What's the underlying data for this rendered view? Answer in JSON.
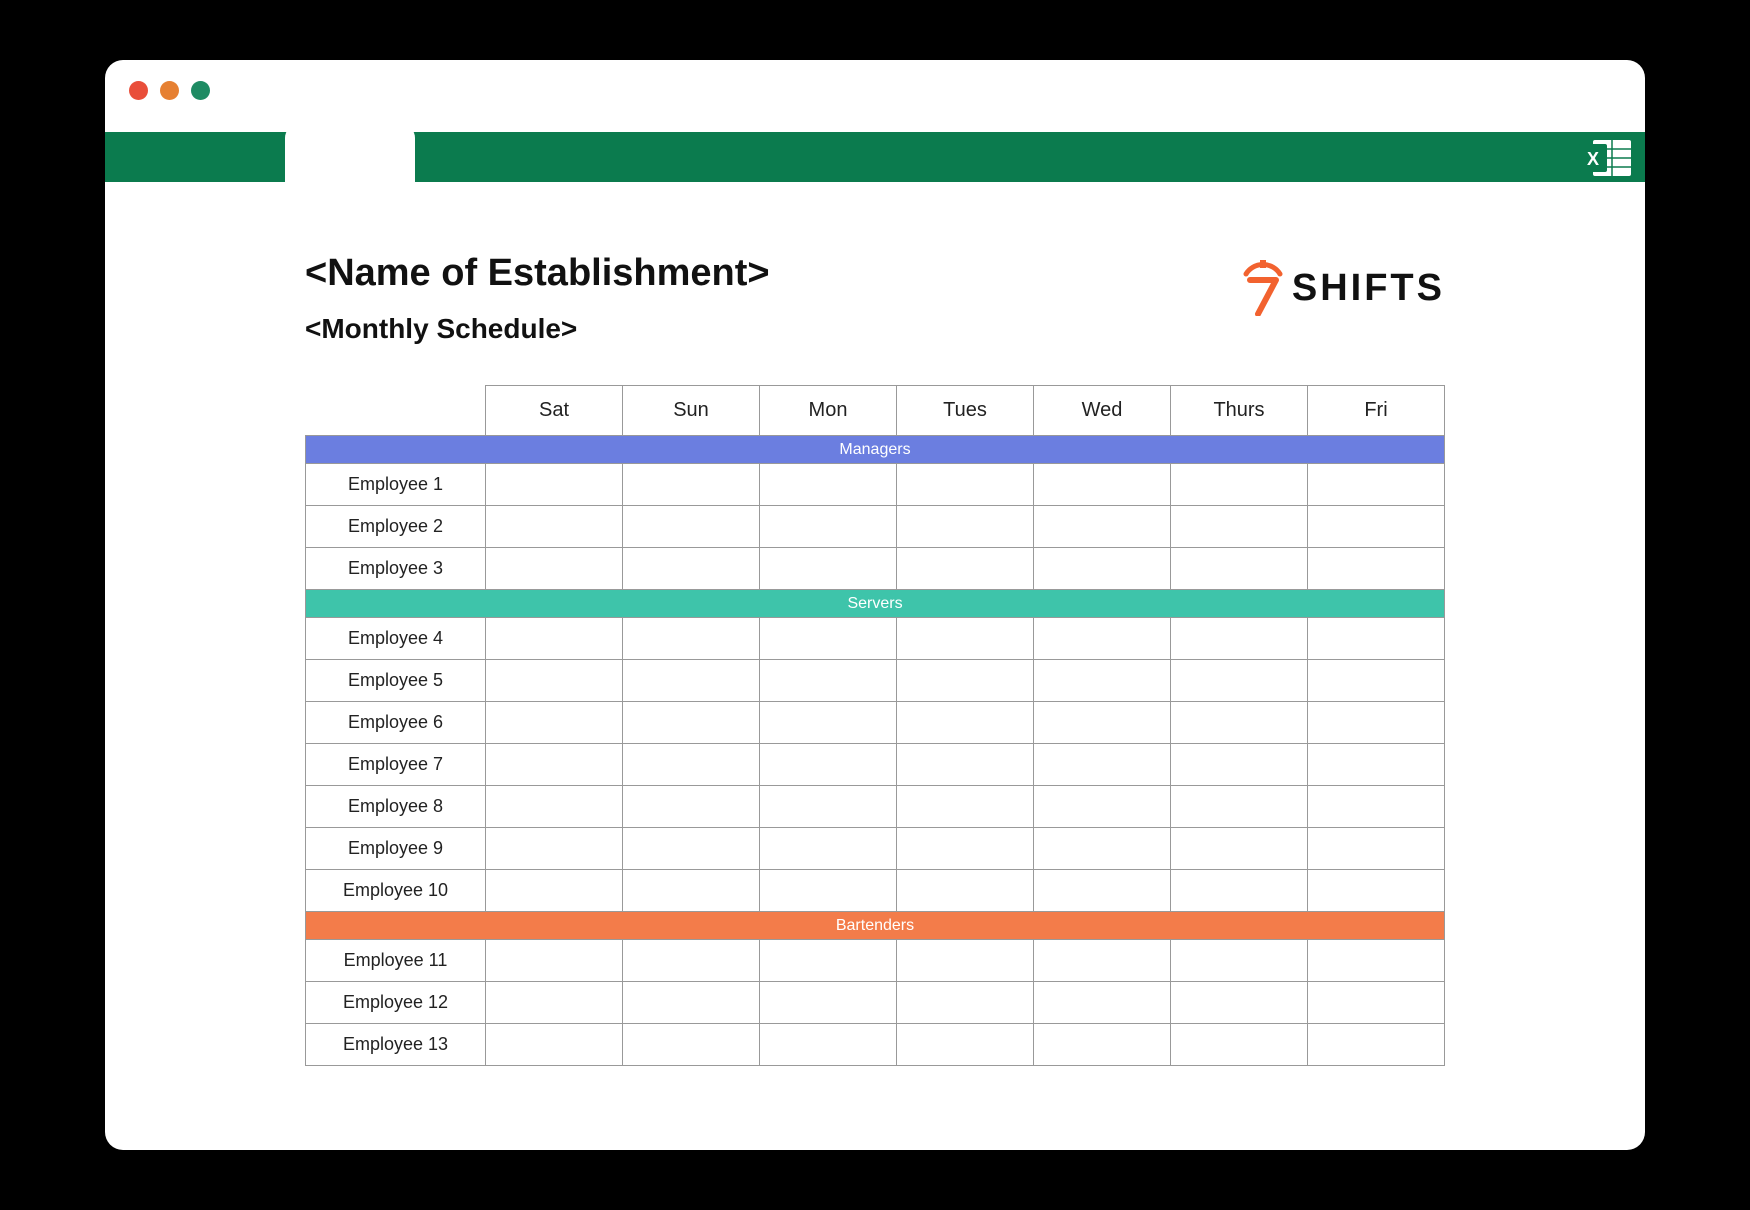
{
  "window": {
    "app_icon": "excel-icon"
  },
  "header": {
    "title": "<Name of Establishment>",
    "subtitle": "<Monthly Schedule>",
    "logo_text": "SHIFTS",
    "logo_digit": "7"
  },
  "schedule": {
    "days": [
      "Sat",
      "Sun",
      "Mon",
      "Tues",
      "Wed",
      "Thurs",
      "Fri"
    ],
    "groups": [
      {
        "name": "Managers",
        "color": "#6b7ee0",
        "employees": [
          "Employee 1",
          "Employee 2",
          "Employee 3"
        ]
      },
      {
        "name": "Servers",
        "color": "#3ec4aa",
        "employees": [
          "Employee 4",
          "Employee 5",
          "Employee 6",
          "Employee 7",
          "Employee 8",
          "Employee 9",
          "Employee 10"
        ]
      },
      {
        "name": "Bartenders",
        "color": "#f37c4a",
        "employees": [
          "Employee 11",
          "Employee 12",
          "Employee 13"
        ]
      }
    ]
  }
}
